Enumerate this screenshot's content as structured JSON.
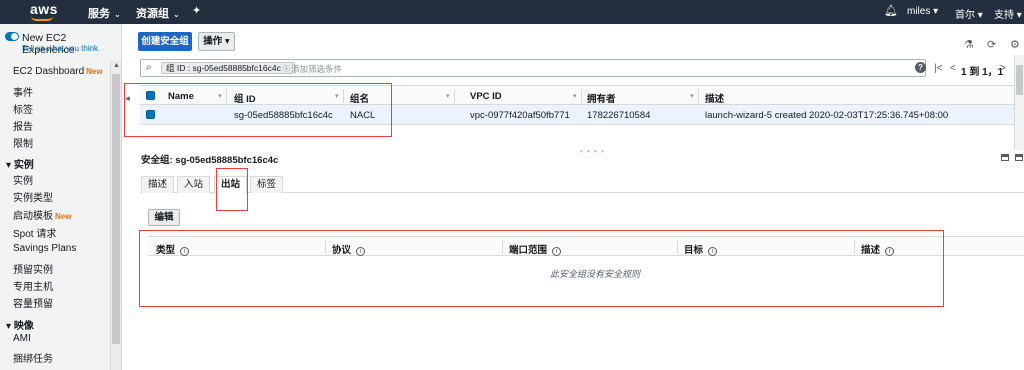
{
  "topnav": {
    "logo": "aws",
    "services": "服务",
    "resource_groups": "资源组",
    "user": "miles",
    "region": "首尔",
    "support": "支持"
  },
  "sidebar": {
    "experience_title": "New EC2 Experience",
    "experience_link": "Tell us what you think",
    "dashboard": "EC2 Dashboard",
    "dashboard_badge": "New",
    "items_top": [
      "事件",
      "标签",
      "报告",
      "限制"
    ],
    "section_instances": "实例",
    "instances_items": [
      "实例",
      "实例类型"
    ],
    "launch_templates": "启动模板",
    "launch_templates_badge": "New",
    "spot": "Spot 请求",
    "savings": "Savings Plans",
    "reserved": "预留实例",
    "dedicated": "专用主机",
    "capacity": "容量预留",
    "section_images": "映像",
    "ami": "AMI",
    "bundle": "捆绑任务"
  },
  "toolbar": {
    "create_button": "创建安全组",
    "actions_button": "操作"
  },
  "search": {
    "chip": "组 ID : sg-05ed58885bfc16c4c",
    "placeholder": "添加筛选条件"
  },
  "pager": {
    "text": "1 到 1，1"
  },
  "table": {
    "columns": [
      "Name",
      "组 ID",
      "组名",
      "VPC ID",
      "拥有者",
      "描述"
    ],
    "rows": [
      {
        "name": "",
        "group_id": "sg-05ed58885bfc16c4c",
        "group_name": "NACL",
        "vpc_id": "vpc-0977f420af50fb771",
        "owner": "178226710584",
        "description": "launch-wizard-5 created 2020-02-03T17:25:36.745+08:00"
      }
    ]
  },
  "detail": {
    "title": "安全组: sg-05ed58885bfc16c4c",
    "tabs": [
      "描述",
      "入站",
      "出站",
      "标签"
    ],
    "active_tab": "出站",
    "edit_button": "编辑",
    "rule_columns": [
      "类型",
      "协议",
      "端口范围",
      "目标",
      "描述"
    ],
    "empty_message": "此安全组没有安全规则"
  },
  "colors": {
    "nav_bg": "#232f3e",
    "primary": "#1e66c2",
    "selected_row": "#eaf3fe",
    "annotation": "#e8413c",
    "badge": "#ec7211"
  }
}
